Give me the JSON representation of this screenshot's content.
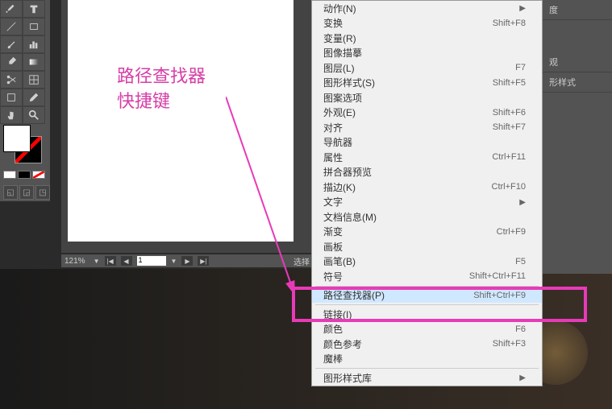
{
  "annotation": {
    "line1": "路径查找器",
    "line2": "快捷键"
  },
  "toolbox": {
    "tools_count": 24
  },
  "statusbar": {
    "zoom": "121%",
    "page": "1",
    "select_text": "选择"
  },
  "right_panels": {
    "tab1": "度",
    "tab2": "观",
    "tab3": "形样式"
  },
  "menu": {
    "items": [
      {
        "label": "动作(N)",
        "shortcut": "",
        "submenu": true
      },
      {
        "label": "变换",
        "shortcut": "Shift+F8"
      },
      {
        "label": "变量(R)",
        "shortcut": ""
      },
      {
        "label": "图像描摹",
        "shortcut": ""
      },
      {
        "label": "图层(L)",
        "shortcut": "F7"
      },
      {
        "label": "图形样式(S)",
        "shortcut": "Shift+F5"
      },
      {
        "label": "图案选项",
        "shortcut": ""
      },
      {
        "label": "外观(E)",
        "shortcut": "Shift+F6"
      },
      {
        "label": "对齐",
        "shortcut": "Shift+F7"
      },
      {
        "label": "导航器",
        "shortcut": ""
      },
      {
        "label": "属性",
        "shortcut": "Ctrl+F11"
      },
      {
        "label": "拼合器预览",
        "shortcut": ""
      },
      {
        "label": "描边(K)",
        "shortcut": "Ctrl+F10"
      },
      {
        "label": "文字",
        "shortcut": "",
        "submenu": true
      },
      {
        "label": "文档信息(M)",
        "shortcut": ""
      },
      {
        "label": "渐变",
        "shortcut": "Ctrl+F9"
      },
      {
        "label": "画板",
        "shortcut": ""
      },
      {
        "label": "画笔(B)",
        "shortcut": "F5"
      },
      {
        "label": "符号",
        "shortcut": "Shift+Ctrl+F11"
      },
      {
        "sep": true
      },
      {
        "label": "路径查找器(P)",
        "shortcut": "Shift+Ctrl+F9",
        "highlighted": true
      },
      {
        "sep": true
      },
      {
        "label": "链接(I)",
        "shortcut": ""
      },
      {
        "label": "颜色",
        "shortcut": "F6"
      },
      {
        "label": "颜色参考",
        "shortcut": "Shift+F3"
      },
      {
        "label": "魔棒",
        "shortcut": ""
      },
      {
        "sep": true
      },
      {
        "label": "图形样式库",
        "shortcut": "",
        "submenu": true
      }
    ]
  }
}
